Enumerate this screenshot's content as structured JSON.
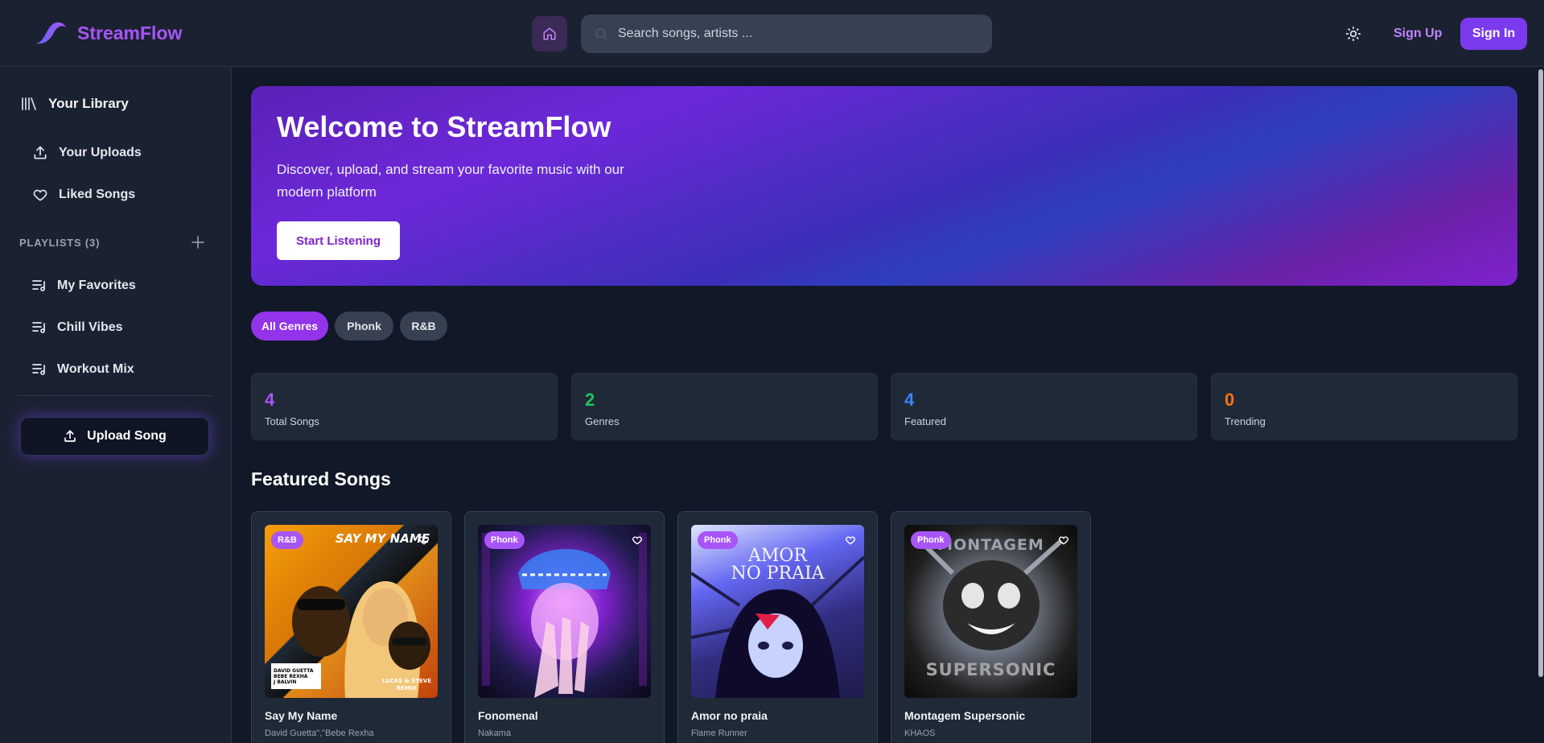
{
  "header": {
    "brand": "StreamFlow",
    "search_placeholder": "Search songs, artists ...",
    "signup_label": "Sign Up",
    "signin_label": "Sign In"
  },
  "sidebar": {
    "library_title": "Your Library",
    "items": [
      {
        "label": "Your Uploads",
        "icon": "upload-icon"
      },
      {
        "label": "Liked Songs",
        "icon": "heart-icon"
      }
    ],
    "playlists_label": "PLAYLISTS (3)",
    "playlists": [
      {
        "label": "My Favorites",
        "icon": "playlist-icon"
      },
      {
        "label": "Chill Vibes",
        "icon": "playlist-icon"
      },
      {
        "label": "Workout Mix",
        "icon": "playlist-icon"
      }
    ],
    "upload_button": "Upload Song"
  },
  "hero": {
    "title": "Welcome to StreamFlow",
    "subtitle": "Discover, upload, and stream your favorite music with our modern platform",
    "cta": "Start Listening"
  },
  "genres": [
    {
      "label": "All Genres",
      "active": true
    },
    {
      "label": "Phonk",
      "active": false
    },
    {
      "label": "R&B",
      "active": false
    }
  ],
  "stats": [
    {
      "value": "4",
      "label": "Total Songs",
      "color": "#a855f7"
    },
    {
      "value": "2",
      "label": "Genres",
      "color": "#22c55e"
    },
    {
      "value": "4",
      "label": "Featured",
      "color": "#3b82f6"
    },
    {
      "value": "0",
      "label": "Trending",
      "color": "#f97316"
    }
  ],
  "featured": {
    "title": "Featured Songs",
    "songs": [
      {
        "title": "Say My Name",
        "artist": "David Guetta\",\"Bebe Rexha",
        "genre": "R&B",
        "art_title": "SAY MY NAME",
        "art_names": [
          "DAVID GUETTA",
          "BEBE REXHA",
          "J BALVIN"
        ],
        "art_remix": [
          "LUCAS & STEVE",
          "REMIX"
        ]
      },
      {
        "title": "Fonomenal",
        "artist": "Nakama",
        "genre": "Phonk"
      },
      {
        "title": "Amor no praia",
        "artist": "Flame Runner",
        "genre": "Phonk",
        "art_title": [
          "AMOR",
          "NO PRAIA"
        ]
      },
      {
        "title": "Montagem Supersonic",
        "artist": "KHAOS",
        "genre": "Phonk",
        "art_title": [
          "MONTAGEM",
          "SUPERSONIC"
        ]
      }
    ]
  }
}
